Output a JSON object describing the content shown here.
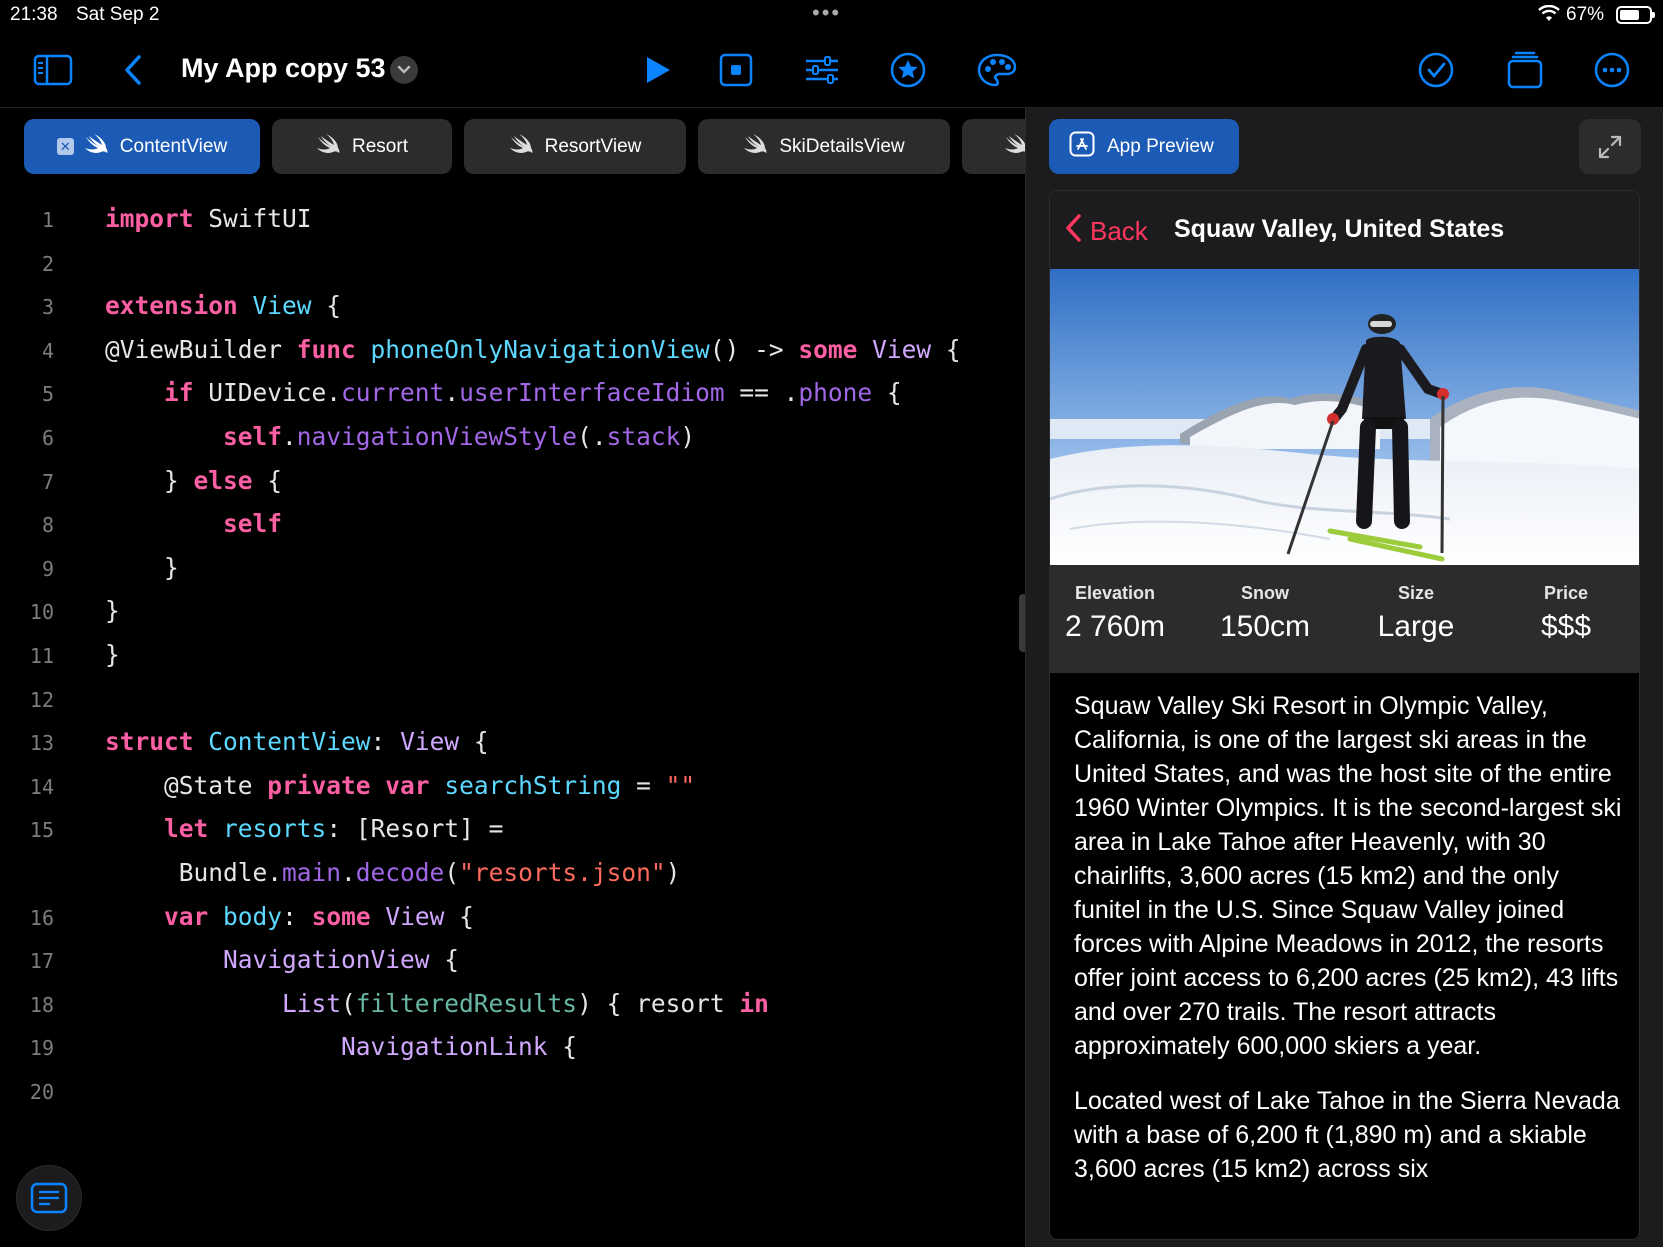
{
  "status_bar": {
    "time": "21:38",
    "date": "Sat Sep 2",
    "battery": "67%",
    "battery_level": 0.67
  },
  "toolbar": {
    "app_title": "My App copy 53",
    "icons": [
      "sidebar-icon",
      "back-chevron-icon",
      "chevron-down-icon",
      "play-icon",
      "stop-icon",
      "sliders-icon",
      "star-icon",
      "palette-icon",
      "checkmark-icon",
      "windows-icon",
      "more-icon"
    ],
    "accent_color": "#0a84ff"
  },
  "tabs": [
    {
      "label": "ContentView",
      "active": true
    },
    {
      "label": "Resort",
      "active": false
    },
    {
      "label": "ResortView",
      "active": false
    },
    {
      "label": "SkiDetailsView",
      "active": false
    }
  ],
  "code_lines": [
    {
      "n": "1",
      "html": "<span class=\"kw\">import</span> SwiftUI"
    },
    {
      "n": "2",
      "html": ""
    },
    {
      "n": "3",
      "html": "<span class=\"kw\">extension</span> <span class=\"ty\">View</span> {"
    },
    {
      "n": "4",
      "html": "@ViewBuilder <span class=\"kw\">func</span> <span class=\"ty\">phoneOnlyNavigationView</span>() -> <span class=\"kw\">some</span> <span class=\"tp\">View</span> {"
    },
    {
      "n": "5",
      "html": "    <span class=\"kw\">if</span> UIDevice.<span class=\"pr\">current</span>.<span class=\"pr\">userInterfaceIdiom</span> == .<span class=\"pr\">phone</span> {"
    },
    {
      "n": "6",
      "html": "        <span class=\"kw\">self</span>.<span class=\"pr\">navigationViewStyle</span>(.<span class=\"pr\">stack</span>)"
    },
    {
      "n": "7",
      "html": "    } <span class=\"kw\">else</span> {"
    },
    {
      "n": "8",
      "html": "        <span class=\"kw\">self</span>"
    },
    {
      "n": "9",
      "html": "    }"
    },
    {
      "n": "10",
      "html": "}"
    },
    {
      "n": "11",
      "html": "}"
    },
    {
      "n": "12",
      "html": ""
    },
    {
      "n": "13",
      "html": "<span class=\"kw\">struct</span> <span class=\"ty\">ContentView</span>: <span class=\"tp\">View</span> {"
    },
    {
      "n": "14",
      "html": "    @State <span class=\"kw\">private</span> <span class=\"kw\">var</span> <span class=\"ty\">searchString</span> = <span class=\"st\">\"\"</span>"
    },
    {
      "n": "15",
      "html": "    <span class=\"kw\">let</span> <span class=\"ty\">resorts</span>: [Resort] ="
    },
    {
      "n": "",
      "html": "     Bundle.<span class=\"pr\">main</span>.<span class=\"pr\">decode</span>(<span class=\"st\">\"resorts.json\"</span>)"
    },
    {
      "n": "16",
      "html": "    <span class=\"kw\">var</span> <span class=\"ty\">body</span>: <span class=\"kw\">some</span> <span class=\"tp\">View</span> {"
    },
    {
      "n": "17",
      "html": "        <span class=\"tp\">NavigationView</span> {"
    },
    {
      "n": "18",
      "html": "            <span class=\"tp\">List</span>(<span class=\"fr\">filteredResults</span>) { resort <span class=\"kw\">in</span>"
    },
    {
      "n": "19",
      "html": "                <span class=\"tp\">NavigationLink</span> {"
    },
    {
      "n": "20",
      "html": ""
    }
  ],
  "preview": {
    "button_label": "App Preview",
    "back_label": "Back",
    "nav_title": "Squaw Valley, United States",
    "stats": [
      {
        "label": "Elevation",
        "value": "2 760m"
      },
      {
        "label": "Snow",
        "value": "150cm"
      },
      {
        "label": "Size",
        "value": "Large"
      },
      {
        "label": "Price",
        "value": "$$$"
      }
    ],
    "description": [
      "Squaw Valley Ski Resort in Olympic Valley, California, is one of the largest ski areas in the United States, and was the host site of the entire 1960 Winter Olympics. It is the second-largest ski area in Lake Tahoe after Heavenly, with 30 chairlifts, 3,600 acres (15 km2) and the only funitel in the U.S. Since Squaw Valley joined forces with Alpine Meadows in 2012, the resorts offer joint access to 6,200 acres (25 km2), 43 lifts and over 270 trails. The resort attracts approximately 600,000 skiers a year.",
      "Located west of Lake Tahoe in the Sierra Nevada with a base of 6,200 ft (1,890 m) and a skiable 3,600 acres (15 km2) across six"
    ],
    "back_color": "#ff375f"
  }
}
